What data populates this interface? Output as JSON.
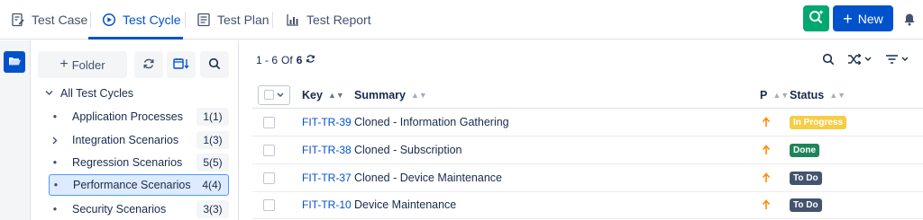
{
  "tabs": [
    {
      "label": "Test Case",
      "icon": "edit-doc-icon"
    },
    {
      "label": "Test Cycle",
      "icon": "cycle-icon"
    },
    {
      "label": "Test Plan",
      "icon": "plan-doc-icon"
    },
    {
      "label": "Test Report",
      "icon": "bar-chart-icon"
    }
  ],
  "header": {
    "new_label": "New"
  },
  "sidebar": {
    "folder_label": "Folder",
    "root_label": "All Test Cycles",
    "items": [
      {
        "name": "Application Processes",
        "count": "1(1)"
      },
      {
        "name": "Integration Scenarios",
        "count": "1(3)"
      },
      {
        "name": "Regression Scenarios",
        "count": "5(5)"
      },
      {
        "name": "Performance Scenarios",
        "count": "4(4)"
      },
      {
        "name": "Security Scenarios",
        "count": "3(3)"
      }
    ]
  },
  "main": {
    "pager": {
      "range": "1 - 6",
      "of": "Of",
      "total": "6"
    },
    "columns": {
      "key": "Key",
      "summary": "Summary",
      "priority": "P",
      "status": "Status"
    },
    "rows": [
      {
        "key": "FIT-TR-39",
        "summary": "Cloned - Information Gathering",
        "status": "In Progress"
      },
      {
        "key": "FIT-TR-38",
        "summary": "Cloned - Subscription",
        "status": "Done"
      },
      {
        "key": "FIT-TR-37",
        "summary": "Cloned - Device Maintenance",
        "status": "To Do"
      },
      {
        "key": "FIT-TR-10",
        "summary": "Device Maintenance",
        "status": "To Do"
      }
    ]
  },
  "colors": {
    "accent": "#0052cc",
    "ai_button": "#00a870",
    "in_progress": "#f5cd47",
    "done": "#1f845a",
    "todo": "#44546f",
    "priority": "#ff8b00"
  }
}
